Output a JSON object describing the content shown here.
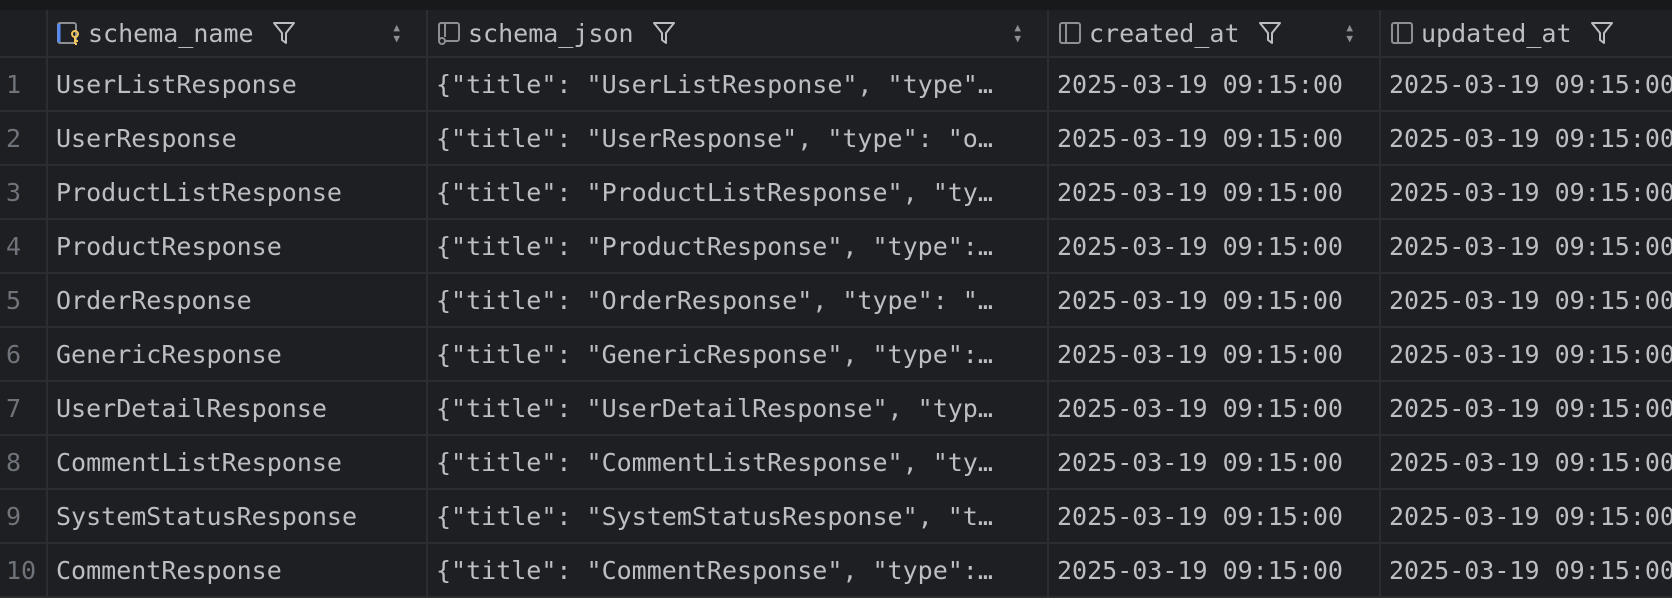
{
  "columns": [
    {
      "name": "schema_name",
      "icon": "primary-key-column-icon"
    },
    {
      "name": "schema_json",
      "icon": "json-column-icon"
    },
    {
      "name": "created_at",
      "icon": "column-icon"
    },
    {
      "name": "updated_at",
      "icon": "column-icon"
    }
  ],
  "rows": [
    {
      "n": "1",
      "schema_name": "UserListResponse",
      "schema_json": "{\"title\": \"UserListResponse\", \"type\"…",
      "created_at": "2025-03-19 09:15:00",
      "updated_at": "2025-03-19 09:15:00"
    },
    {
      "n": "2",
      "schema_name": "UserResponse",
      "schema_json": "{\"title\": \"UserResponse\", \"type\": \"o…",
      "created_at": "2025-03-19 09:15:00",
      "updated_at": "2025-03-19 09:15:00"
    },
    {
      "n": "3",
      "schema_name": "ProductListResponse",
      "schema_json": "{\"title\": \"ProductListResponse\", \"ty…",
      "created_at": "2025-03-19 09:15:00",
      "updated_at": "2025-03-19 09:15:00"
    },
    {
      "n": "4",
      "schema_name": "ProductResponse",
      "schema_json": "{\"title\": \"ProductResponse\", \"type\":…",
      "created_at": "2025-03-19 09:15:00",
      "updated_at": "2025-03-19 09:15:00"
    },
    {
      "n": "5",
      "schema_name": "OrderResponse",
      "schema_json": "{\"title\": \"OrderResponse\", \"type\": \"…",
      "created_at": "2025-03-19 09:15:00",
      "updated_at": "2025-03-19 09:15:00"
    },
    {
      "n": "6",
      "schema_name": "GenericResponse",
      "schema_json": "{\"title\": \"GenericResponse\", \"type\":…",
      "created_at": "2025-03-19 09:15:00",
      "updated_at": "2025-03-19 09:15:00"
    },
    {
      "n": "7",
      "schema_name": "UserDetailResponse",
      "schema_json": "{\"title\": \"UserDetailResponse\", \"typ…",
      "created_at": "2025-03-19 09:15:00",
      "updated_at": "2025-03-19 09:15:00"
    },
    {
      "n": "8",
      "schema_name": "CommentListResponse",
      "schema_json": "{\"title\": \"CommentListResponse\", \"ty…",
      "created_at": "2025-03-19 09:15:00",
      "updated_at": "2025-03-19 09:15:00"
    },
    {
      "n": "9",
      "schema_name": "SystemStatusResponse",
      "schema_json": "{\"title\": \"SystemStatusResponse\", \"t…",
      "created_at": "2025-03-19 09:15:00",
      "updated_at": "2025-03-19 09:15:00"
    },
    {
      "n": "10",
      "schema_name": "CommentResponse",
      "schema_json": "{\"title\": \"CommentResponse\", \"type\":…",
      "created_at": "2025-03-19 09:15:00",
      "updated_at": "2025-03-19 09:15:00"
    }
  ]
}
